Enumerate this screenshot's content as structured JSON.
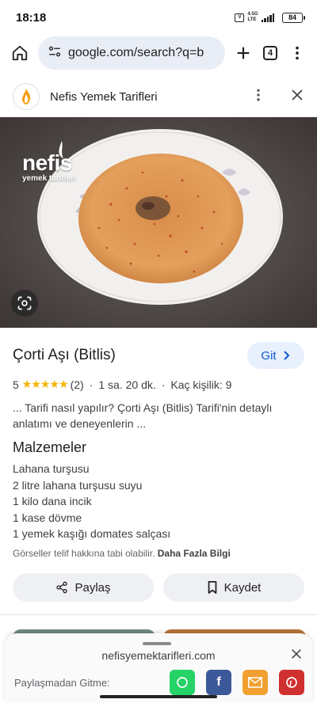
{
  "status_bar": {
    "time": "18:18",
    "network_top": "4.5G",
    "network_bottom": "LTE",
    "battery": "84"
  },
  "browser": {
    "url": "google.com/search?q=b",
    "tab_count": "4",
    "icons": [
      "home-icon",
      "site-info-icon",
      "plus-icon",
      "tab-switcher-icon",
      "more-vert-icon"
    ]
  },
  "site": {
    "name": "Nefis Yemek Tarifleri",
    "icons": [
      "site-logo-icon",
      "more-vert-icon",
      "close-icon"
    ]
  },
  "hero": {
    "watermark_main": "nefis",
    "watermark_sub": "yemek tarifleri"
  },
  "recipe": {
    "title": "Çorti Aşı (Bitlis)",
    "go_button": "Git",
    "rating": "5",
    "stars": "★★★★★",
    "review_count": "(2)",
    "duration": "1 sa. 20 dk.",
    "servings": "Kaç kişilik: 9",
    "description": "... Tarifi nasıl yapılır? Çorti Aşı (Bitlis) Tarifi'nin detaylı anlatımı ve deneyenlerin ...",
    "ingredients_title": "Malzemeler",
    "ingredients": [
      "Lahana turşusu",
      "2 litre lahana turşusu suyu",
      "1 kilo dana incik",
      "1 kase dövme",
      "1 yemek kaşığı domates salçası"
    ],
    "copyright": "Görseller telif hakkına tabi olabilir.",
    "more_info": "Daha Fazla Bilgi",
    "share_button": "Paylaş",
    "save_button": "Kaydet"
  },
  "sheet": {
    "url": "nefisyemektarifleri.com",
    "share_label": "Paylaşmadan Gitme:",
    "share_targets": [
      "whatsapp-icon",
      "facebook-icon",
      "email-icon",
      "pinterest-icon"
    ]
  },
  "colors": {
    "accent": "#0b57d0",
    "button_bg": "#e8f0fe",
    "star": "#f4b400",
    "whatsapp": "#25d366",
    "facebook": "#3b5998",
    "email": "#f0a030",
    "pinterest": "#d0302f"
  }
}
